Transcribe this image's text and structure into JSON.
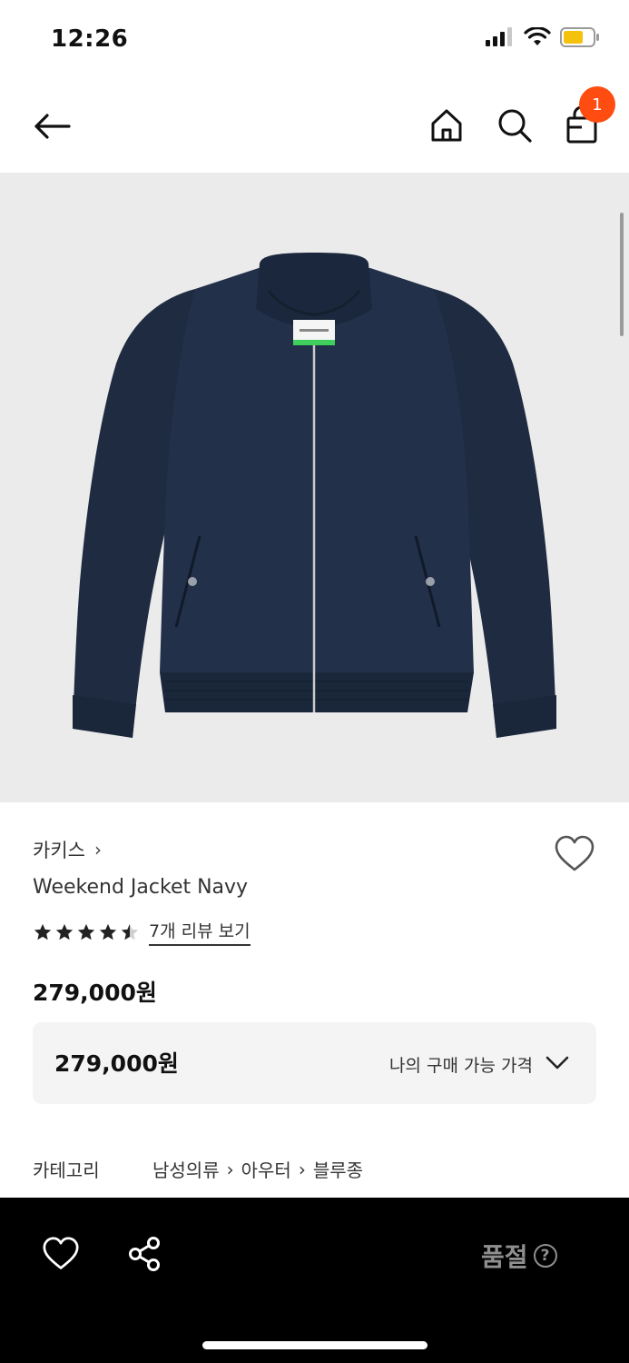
{
  "status_bar": {
    "time": "12:26"
  },
  "nav": {
    "cart_count": "1"
  },
  "product": {
    "brand": "카키스",
    "name": "Weekend Jacket Navy",
    "rating": 4.5,
    "review_link": "7개 리뷰 보기",
    "price": "279,000원",
    "my_price_value": "279,000원",
    "my_price_label": "나의 구매 가능 가격",
    "category_label": "카테고리",
    "category_path": [
      "남성의류",
      "아우터",
      "블루종"
    ]
  },
  "bottom_bar": {
    "soldout_label": "품절"
  },
  "colors": {
    "badge": "#ff4d12",
    "jacket": "#1f2d44",
    "image_bg": "#ebebeb",
    "bottom_bar": "#000000"
  }
}
